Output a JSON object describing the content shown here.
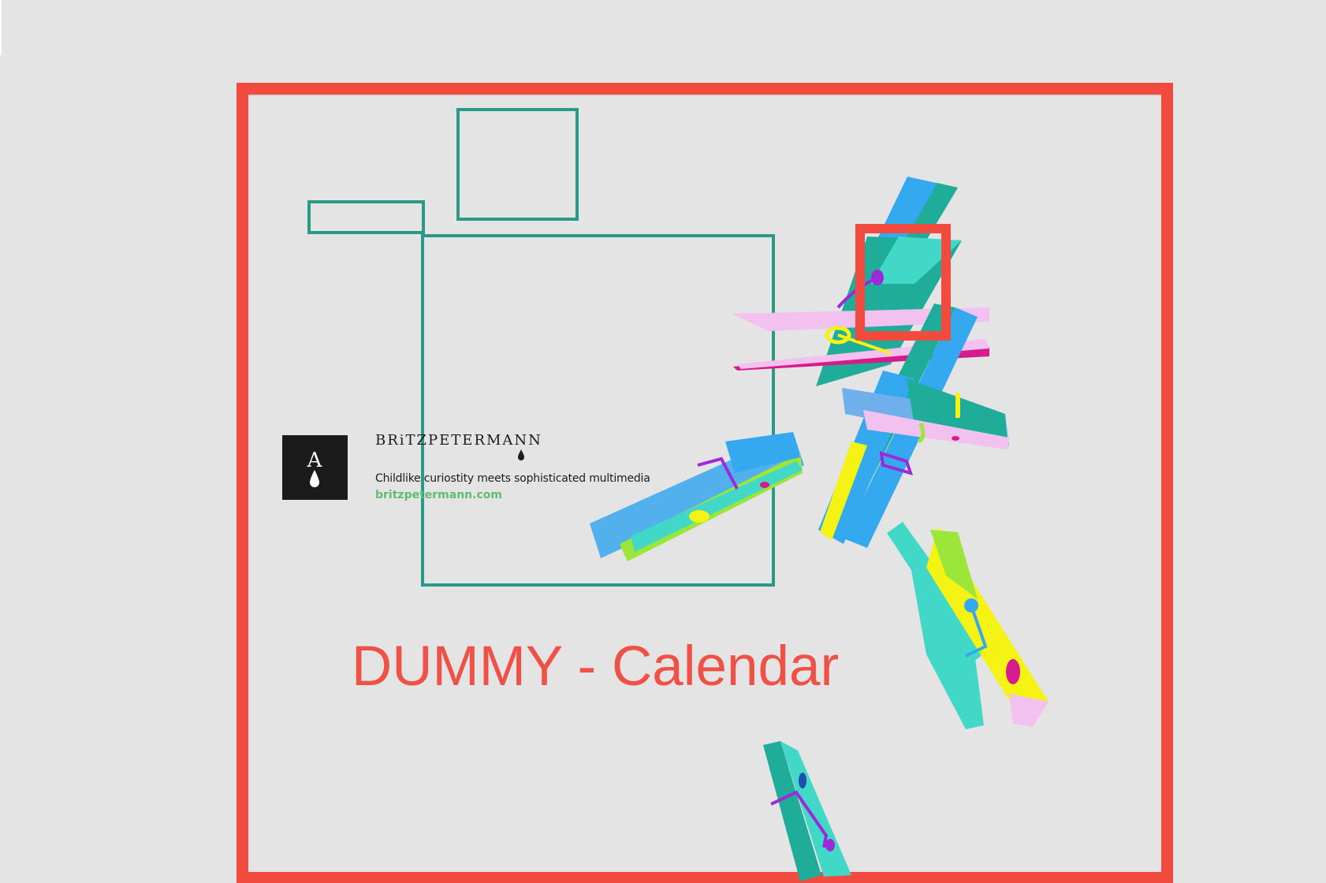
{
  "page": {
    "title": "DUMMY - Calendar",
    "background_color": "#e3e4e3",
    "frame_color": "#f14b40",
    "box_color": "#2a9a86"
  },
  "brand": {
    "logo_letter": "A",
    "name": "BRiTZPETERMANN",
    "tagline": "Childlike curiostity meets sophisticated multimedia",
    "website": "britzpetermann.com",
    "link_color": "#5fbd71"
  },
  "decorations": {
    "illustration": "clothespins",
    "colors": [
      "#35a9f0",
      "#1fad9a",
      "#f2c1ef",
      "#42d8c8",
      "#f5f314",
      "#9ce63a",
      "#d81b8c",
      "#9d2ad8"
    ]
  }
}
